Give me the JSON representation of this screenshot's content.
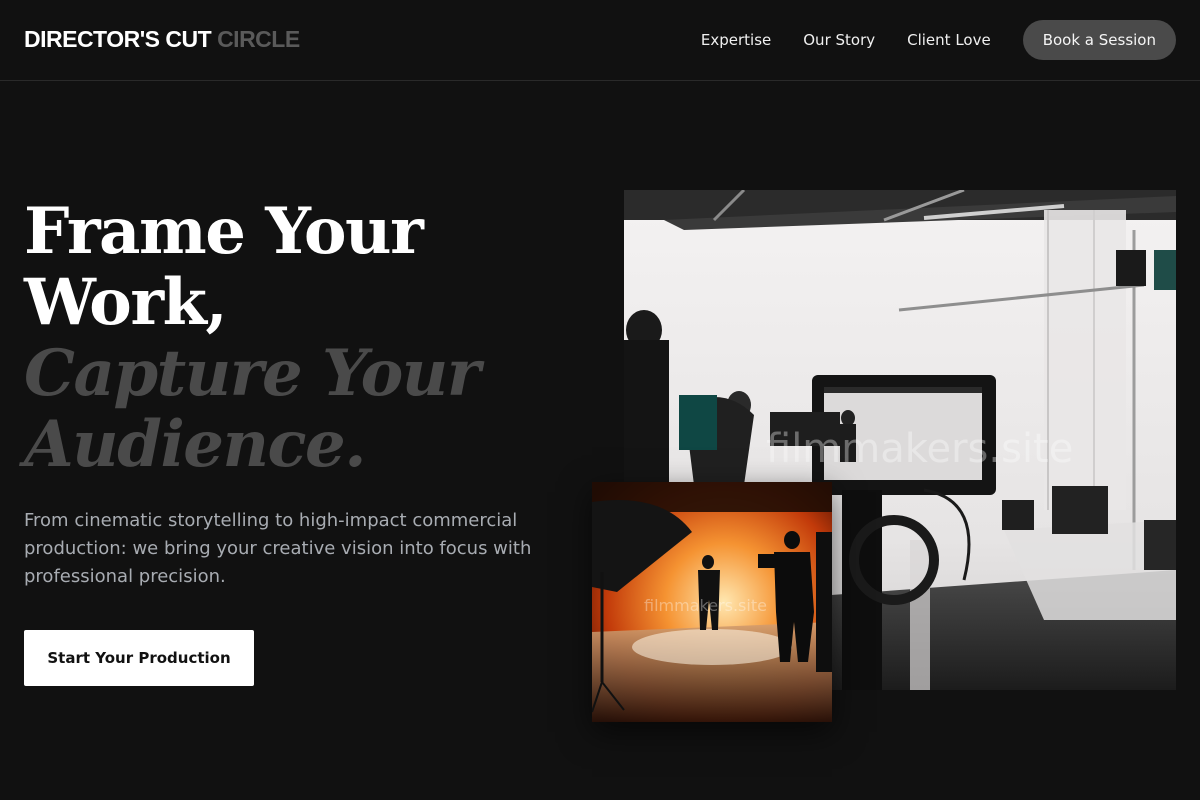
{
  "brand": {
    "primary": "DIRECTOR'S CUT",
    "secondary": "CIRCLE"
  },
  "nav": {
    "items": [
      "Expertise",
      "Our Story",
      "Client Love"
    ],
    "book_label": "Book a Session"
  },
  "hero": {
    "headline_lines": [
      "Frame Your",
      "Work,"
    ],
    "headline_accent_lines": [
      "Capture Your",
      "Audience."
    ],
    "subcopy": "From cinematic storytelling to high-impact commercial production: we bring your creative vision into focus with professional precision.",
    "cta_label": "Start Your Production"
  },
  "images": {
    "main_watermark": "filmmakers.site",
    "small_watermark": "filmmakers.site"
  },
  "colors": {
    "background": "#111111",
    "text": "#ffffff",
    "muted_heading": "#4a4a4a",
    "body_text": "#a8acb2",
    "book_button": "#4a4a4a",
    "cta_background": "#ffffff"
  }
}
